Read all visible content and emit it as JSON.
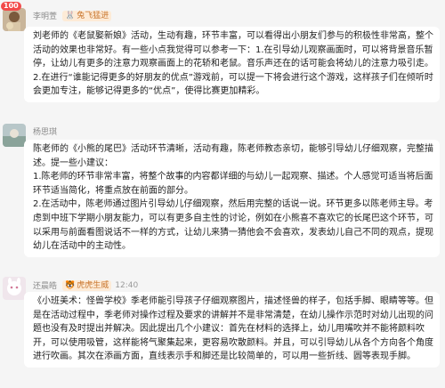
{
  "messages": [
    {
      "sender": "李明萱",
      "badge": "兔飞猛进",
      "badge_icon": "rabbit-icon",
      "time": "",
      "paragraphs": [
        "刘老师的《老鼠娶新娘》活动，生动有趣，环节丰富，可以看得出小朋友们参与的积极性非常高，整个活动的效果也非常好。有一些小点我觉得可以参考一下：1.在引导幼儿观察画面时，可以将背景音乐暂停，让幼儿有更多的注意力观察画面上的花轿和老鼠。音乐声还在的话可能会将幼儿的注意力吸引走。2.在进行“谁能记得更多的好朋友的优点”游戏前，可以提一下将会进行这个游戏，这样孩子们在倾听时会更加专注，能够记得更多的“优点”，使得比赛更加精彩。"
      ]
    },
    {
      "sender": "杨思琪",
      "badge": "",
      "time": "",
      "paragraphs": [
        "陈老师的《小熊的尾巴》活动环节清晰，活动有趣，陈老师教态亲切，能够引导幼儿仔细观察，完整描述。提一些小建议：",
        "1.陈老师的环节非常丰富，将整个故事的内容都详细的与幼儿一起观察、描述。个人感觉可适当将后面环节适当简化，将重点放在前面的部分。",
        "2.在活动中，陈老师通过图片引导幼儿仔细观察，然后用完整的话说一说。环节更多以陈老师主导。考虑到中班下学期小朋友能力，可以有更多自主性的讨论，例如在小熊喜不喜欢它的长尾巴这个环节，可以采用与前面看图说话不一样的方式，让幼儿来猜一猜他会不会喜欢，发表幼儿自己不同的观点，提现幼儿在活动中的主动性。"
      ]
    },
    {
      "sender": "还晨皓",
      "badge": "虎虎生威",
      "badge_icon": "tiger-icon",
      "time": "12:40",
      "paragraphs": [
        "《小班美术：怪兽学校》季老师能引导孩子仔细观察图片，描述怪兽的样子，包括手脚、眼睛等等。但是在活动过程中，季老师对操作过程及要求的讲解并不是非常清楚，在幼儿操作示范时对幼儿出现的问题也没有及时提出并解决。因此提出几个小建议：首先在材料的选择上，幼儿用嘴吹并不能将颜料吹开，可以使用吸管，这样能将气聚集起来，更容易吹散颜料。并且，可以引导幼儿从各个方向各个角度进行吹画。其次在添画方面，直线表示手和脚还是比较简单的，可以用一些折线、圆等表现手脚。"
      ]
    }
  ],
  "unread_count": "100"
}
